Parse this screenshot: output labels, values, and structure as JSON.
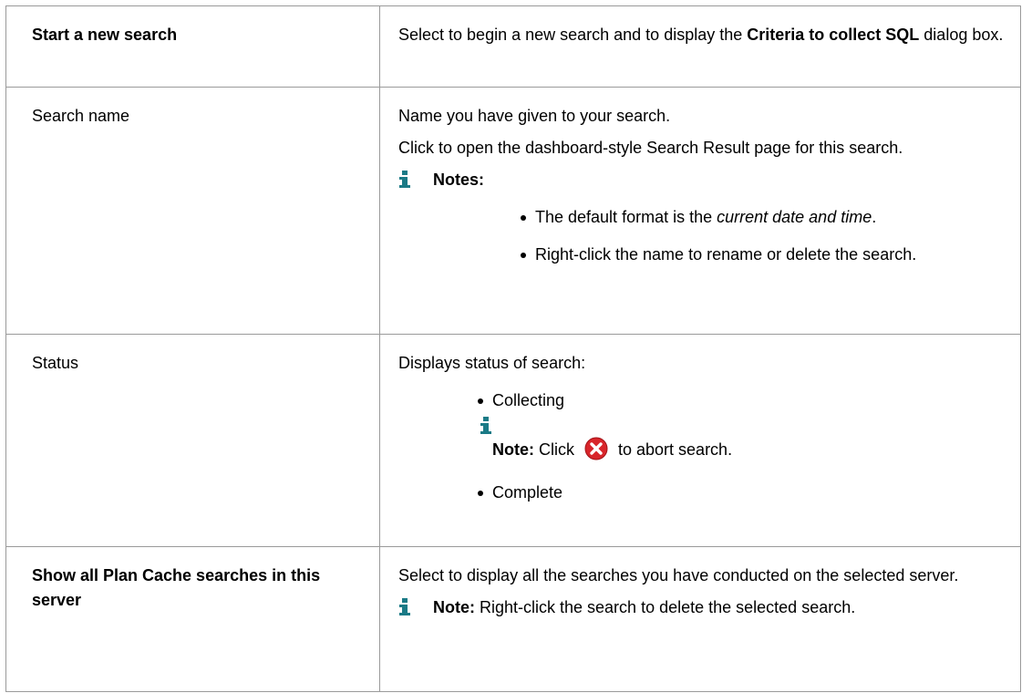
{
  "rows": [
    {
      "term": "Start a new search",
      "desc": {
        "pre": "Select to begin a new search and to display the ",
        "bold": "Criteria to collect SQL",
        "post": " dialog box."
      }
    },
    {
      "term": "Search name",
      "desc": {
        "line1": "Name you have given to your search.",
        "line2": "Click to open the dashboard-style Search Result page for this search.",
        "note_label": "Notes:",
        "bullet1_pre": "The default format is the ",
        "bullet1_italic": "current date and time",
        "bullet1_post": ".",
        "bullet2": "Right-click the name to rename or delete the search."
      }
    },
    {
      "term": "Status",
      "desc": {
        "line1": "Displays status of search:",
        "bullet1": "Collecting",
        "note_label": "Note:",
        "note_pre": " Click ",
        "note_post": " to abort search.",
        "bullet2": "Complete"
      }
    },
    {
      "term": "Show all Plan Cache searches in this server",
      "desc": {
        "line1": "Select to display all the searches you have conducted on the selected server.",
        "note_label": "Note:",
        "note_text": " Right-click the search to delete the selected search."
      }
    }
  ],
  "icons": {
    "info": "info-icon",
    "abort": "abort-x-icon"
  },
  "colors": {
    "info_icon": "#1a7a86",
    "abort_icon": "#d8262b",
    "border": "#9a9a9a"
  }
}
